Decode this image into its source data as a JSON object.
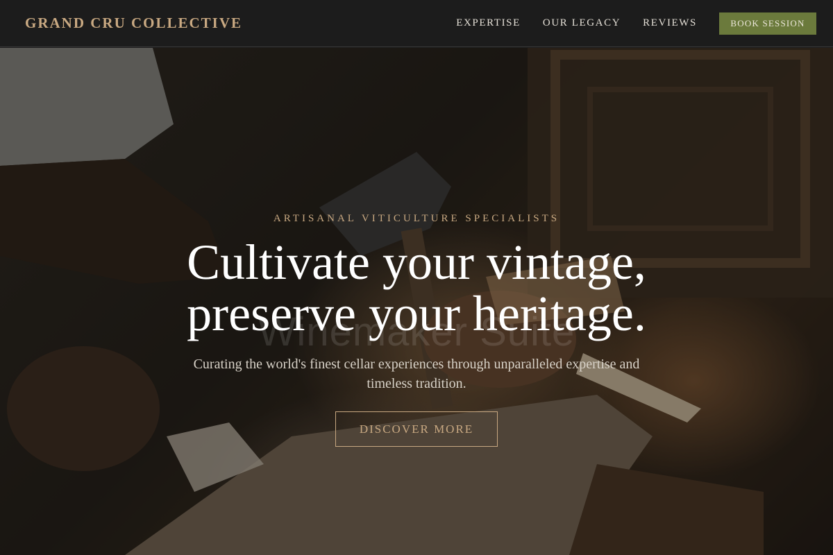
{
  "header": {
    "brand": "GRAND CRU COLLECTIVE",
    "nav": [
      {
        "label": "EXPERTISE"
      },
      {
        "label": "OUR LEGACY"
      },
      {
        "label": "REVIEWS"
      }
    ],
    "cta_label": "BOOK SESSION"
  },
  "hero": {
    "eyebrow": "ARTISANAL VITICULTURE SPECIALISTS",
    "headline_line1": "Cultivate your vintage,",
    "headline_line2": "preserve your heritage.",
    "watermark": "Winemaker Suite",
    "subline": "Curating the world's finest cellar experiences through unparalleled expertise and timeless tradition.",
    "button_label": "DISCOVER MORE",
    "background_image": "craftsman chiseling wood with hammer"
  },
  "colors": {
    "accent_gold": "#c9a982",
    "cta_olive": "#6b7a3c",
    "header_bg": "#1c1c1c"
  }
}
